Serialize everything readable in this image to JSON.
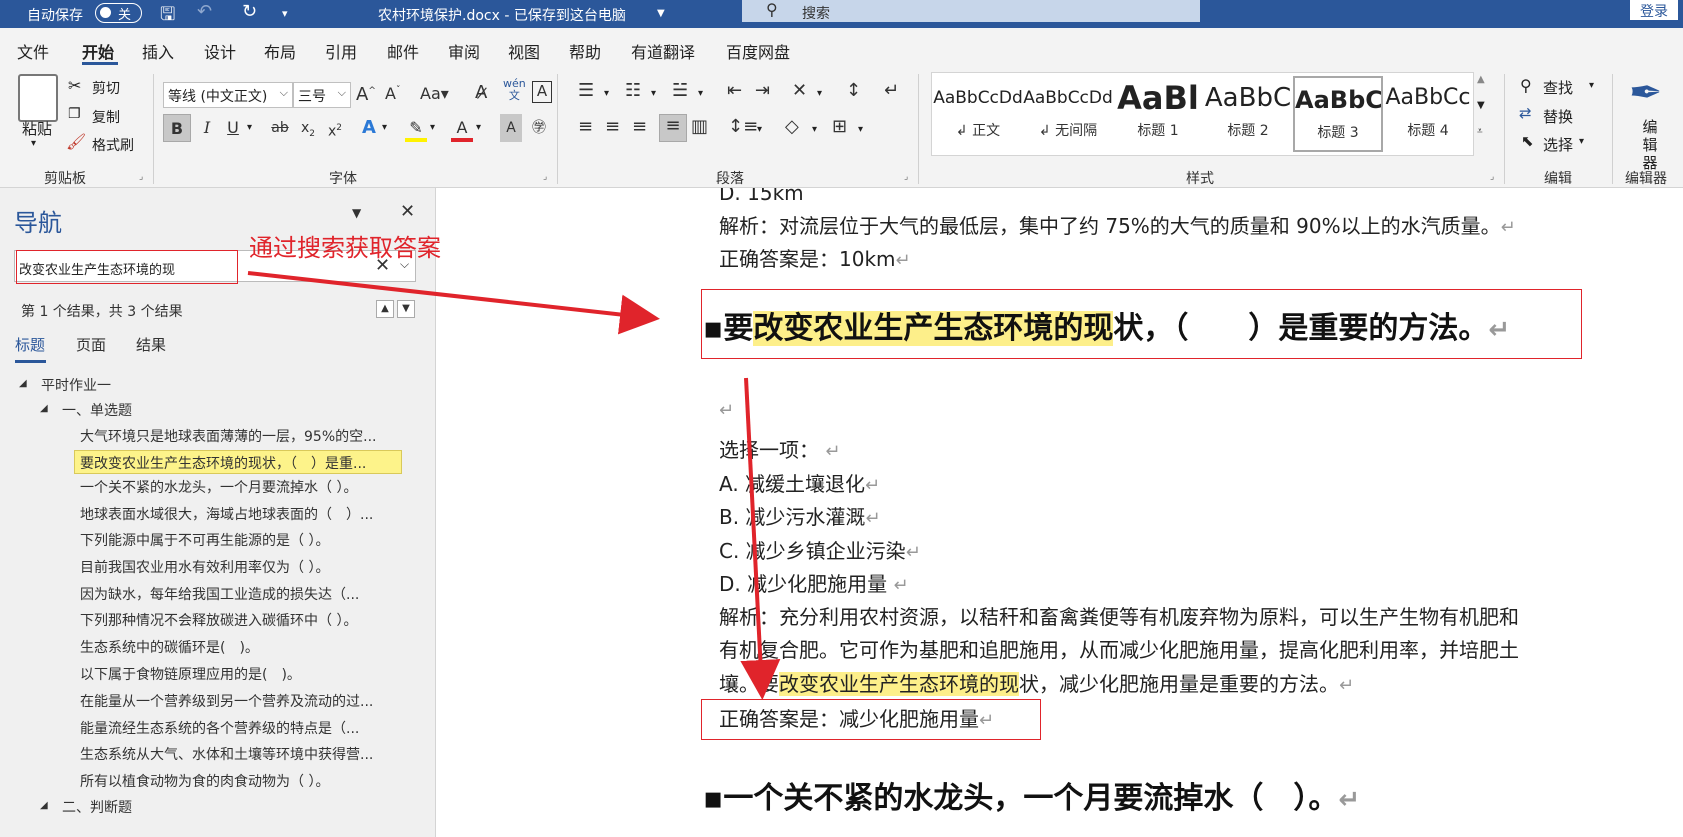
{
  "titlebar": {
    "autosave_label": "自动保存",
    "autosave_state": "关",
    "doc_title": "农村环境保护.docx - 已保存到这台电脑",
    "search_placeholder": "搜索",
    "login_button": "登录"
  },
  "menu": {
    "items": [
      "文件",
      "开始",
      "插入",
      "设计",
      "布局",
      "引用",
      "邮件",
      "审阅",
      "视图",
      "帮助",
      "有道翻译",
      "百度网盘"
    ],
    "active": "开始"
  },
  "ribbon": {
    "clipboard": {
      "paste": "粘贴",
      "cut": "剪切",
      "copy": "复制",
      "format_painter": "格式刷",
      "group": "剪贴板"
    },
    "font": {
      "font_name": "等线 (中文正文)",
      "font_size": "三号",
      "group": "字体"
    },
    "paragraph": {
      "group": "段落"
    },
    "styles": {
      "items": [
        {
          "preview": "AaBbCcDd",
          "name": "正文"
        },
        {
          "preview": "AaBbCcDd",
          "name": "无间隔"
        },
        {
          "preview": "AaBl",
          "name": "标题 1"
        },
        {
          "preview": "AaBbC",
          "name": "标题 2"
        },
        {
          "preview": "AaBbC",
          "name": "标题 3"
        },
        {
          "preview": "AaBbCc",
          "name": "标题 4"
        }
      ],
      "group": "样式"
    },
    "editing": {
      "find": "查找",
      "replace": "替换",
      "select": "选择",
      "group": "编辑"
    },
    "editor": {
      "label": "编辑器",
      "group": "编辑器"
    }
  },
  "nav": {
    "title": "导航",
    "search_value": "改变农业生产生态环境的现",
    "result_text": "第 1 个结果，共 3 个结果",
    "tabs": [
      "标题",
      "页面",
      "结果"
    ],
    "tree": [
      {
        "text": "平时作业一",
        "level": 0
      },
      {
        "text": "一、单选题",
        "level": 1
      },
      {
        "text": "大气环境只是地球表面薄薄的一层，95%的空...",
        "level": 2
      },
      {
        "text": "要改变农业生产生态环境的现状，（　）是重...",
        "level": 2,
        "selected": true
      },
      {
        "text": "一个关不紧的水龙头，一个月要流掉水（ ）。",
        "level": 2
      },
      {
        "text": "地球表面水域很大，海域占地球表面的（　）...",
        "level": 2
      },
      {
        "text": "下列能源中属于不可再生能源的是（ ）。",
        "level": 2
      },
      {
        "text": "目前我国农业用水有效利用率仅为（ ）。",
        "level": 2
      },
      {
        "text": "因为缺水，每年给我国工业造成的损失达（...",
        "level": 2
      },
      {
        "text": "下列那种情况不会释放碳进入碳循环中（ ）。",
        "level": 2
      },
      {
        "text": "生态系统中的碳循环是(　)。",
        "level": 2
      },
      {
        "text": "以下属于食物链原理应用的是(　)。",
        "level": 2
      },
      {
        "text": "在能量从一个营养级到另一个营养及流动的过...",
        "level": 2
      },
      {
        "text": "能量流经生态系统的各个营养级的特点是（...",
        "level": 2
      },
      {
        "text": "生态系统从大气、水体和土壤等环境中获得营...",
        "level": 2
      },
      {
        "text": "所有以植食动物为食的肉食动物为（ ）。",
        "level": 2
      },
      {
        "text": "二、判断题",
        "level": 1
      }
    ]
  },
  "annotation": "通过搜索获取答案",
  "document": {
    "prev_option": "D. 15km",
    "prev_analysis": "解析：对流层位于大气的最低层，集中了约 75%的大气的质量和 90%以上的水汽质量。",
    "prev_answer": "正确答案是：10km",
    "q_pre": "要",
    "q_hl": "改变农业生产生态环境的现",
    "q_post": "状，（　　）是重要的方法。",
    "choose": "选择一项：",
    "options": [
      "A.  减缓土壤退化",
      "B.  减少污水灌溉",
      "C.  减少乡镇企业污染",
      "D.  减少化肥施用量"
    ],
    "analysis_1": "解析：充分利用农村资源，以秸秆和畜禽粪便等有机废弃物为原料，可以生产生物有机肥和",
    "analysis_2": "有机复合肥。它可作为基肥和追肥施用，从而减少化肥施用量，提高化肥利用率，并培肥土",
    "analysis_3_pre": "壤。要",
    "analysis_3_hl": "改变农业生产生态环境的现",
    "analysis_3_post": "状，减少化肥施用量是重要的方法。",
    "answer": "正确答案是：减少化肥施用量",
    "next_q": "一个关不紧的水龙头，一个月要流掉水（　）。"
  },
  "colors": {
    "accent": "#2b579a",
    "highlight": "#fdef8a",
    "annotation_red": "#e0242b"
  }
}
